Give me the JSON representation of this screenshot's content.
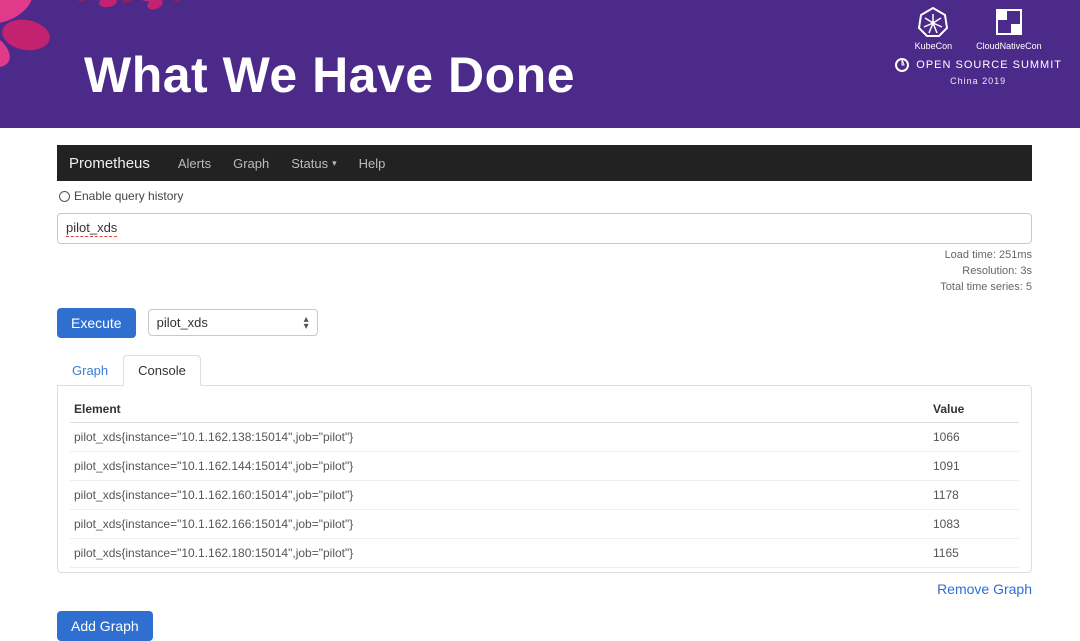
{
  "slide": {
    "title": "What We Have Done",
    "logos": {
      "kubecon": "KubeCon",
      "cnc": "CloudNativeCon",
      "oss": "OPEN SOURCE SUMMIT",
      "china": "China 2019"
    }
  },
  "prom": {
    "brand": "Prometheus",
    "nav": {
      "alerts": "Alerts",
      "graph": "Graph",
      "status": "Status",
      "help": "Help"
    },
    "enable_label": "Enable query history",
    "query_text": "pilot_xds",
    "stats": {
      "load": "Load time: 251ms",
      "resolution": "Resolution: 3s",
      "series": "Total time series: 5"
    },
    "execute_label": "Execute",
    "select_value": "pilot_xds",
    "tabs": {
      "graph": "Graph",
      "console": "Console"
    },
    "table_headers": {
      "element": "Element",
      "value": "Value"
    },
    "rows": [
      {
        "element": "pilot_xds{instance=\"10.1.162.138:15014\",job=\"pilot\"}",
        "value": "1066"
      },
      {
        "element": "pilot_xds{instance=\"10.1.162.144:15014\",job=\"pilot\"}",
        "value": "1091"
      },
      {
        "element": "pilot_xds{instance=\"10.1.162.160:15014\",job=\"pilot\"}",
        "value": "1178"
      },
      {
        "element": "pilot_xds{instance=\"10.1.162.166:15014\",job=\"pilot\"}",
        "value": "1083"
      },
      {
        "element": "pilot_xds{instance=\"10.1.162.180:15014\",job=\"pilot\"}",
        "value": "1165"
      }
    ],
    "remove_label": "Remove Graph",
    "add_label": "Add Graph"
  }
}
